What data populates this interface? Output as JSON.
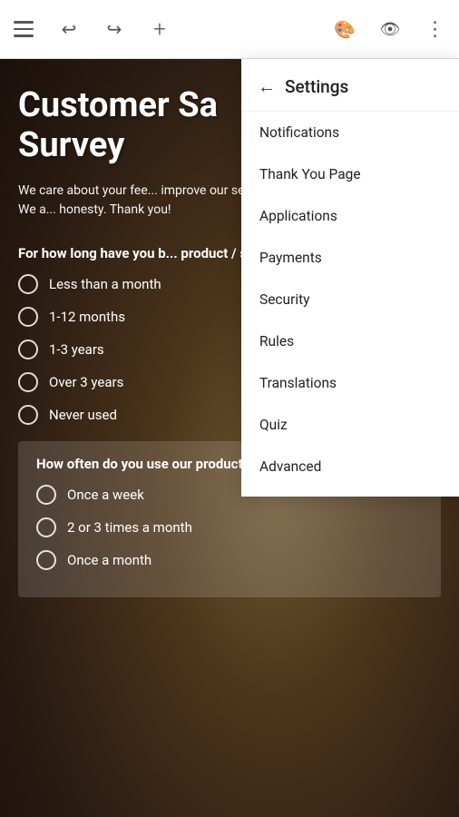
{
  "toolbar": {
    "hamburger_label": "menu",
    "undo_label": "undo",
    "redo_label": "redo",
    "add_label": "add",
    "palette_label": "palette",
    "preview_label": "preview",
    "more_label": "more options"
  },
  "survey": {
    "title": "Customer Sa... Survey",
    "title_line1": "Customer Sa",
    "title_line2": "Survey",
    "description": "We care about your fee... improve our services in a... satisfactory to you. We a... honesty. Thank you!",
    "question1": "For how long have you b... product / service?",
    "options1": [
      "Less than a month",
      "1-12 months",
      "1-3 years",
      "Over 3 years",
      "Never used"
    ],
    "question2": "How often do you use our product / service?",
    "options2": [
      "Once a week",
      "2 or 3 times a month",
      "Once a month"
    ]
  },
  "settings": {
    "panel_title": "Settings",
    "back_label": "back",
    "menu_items": [
      {
        "label": "Notifications",
        "id": "notifications"
      },
      {
        "label": "Thank You Page",
        "id": "thank-you-page"
      },
      {
        "label": "Applications",
        "id": "applications"
      },
      {
        "label": "Payments",
        "id": "payments"
      },
      {
        "label": "Security",
        "id": "security"
      },
      {
        "label": "Rules",
        "id": "rules"
      },
      {
        "label": "Translations",
        "id": "translations"
      },
      {
        "label": "Quiz",
        "id": "quiz"
      },
      {
        "label": "Advanced",
        "id": "advanced"
      }
    ]
  }
}
